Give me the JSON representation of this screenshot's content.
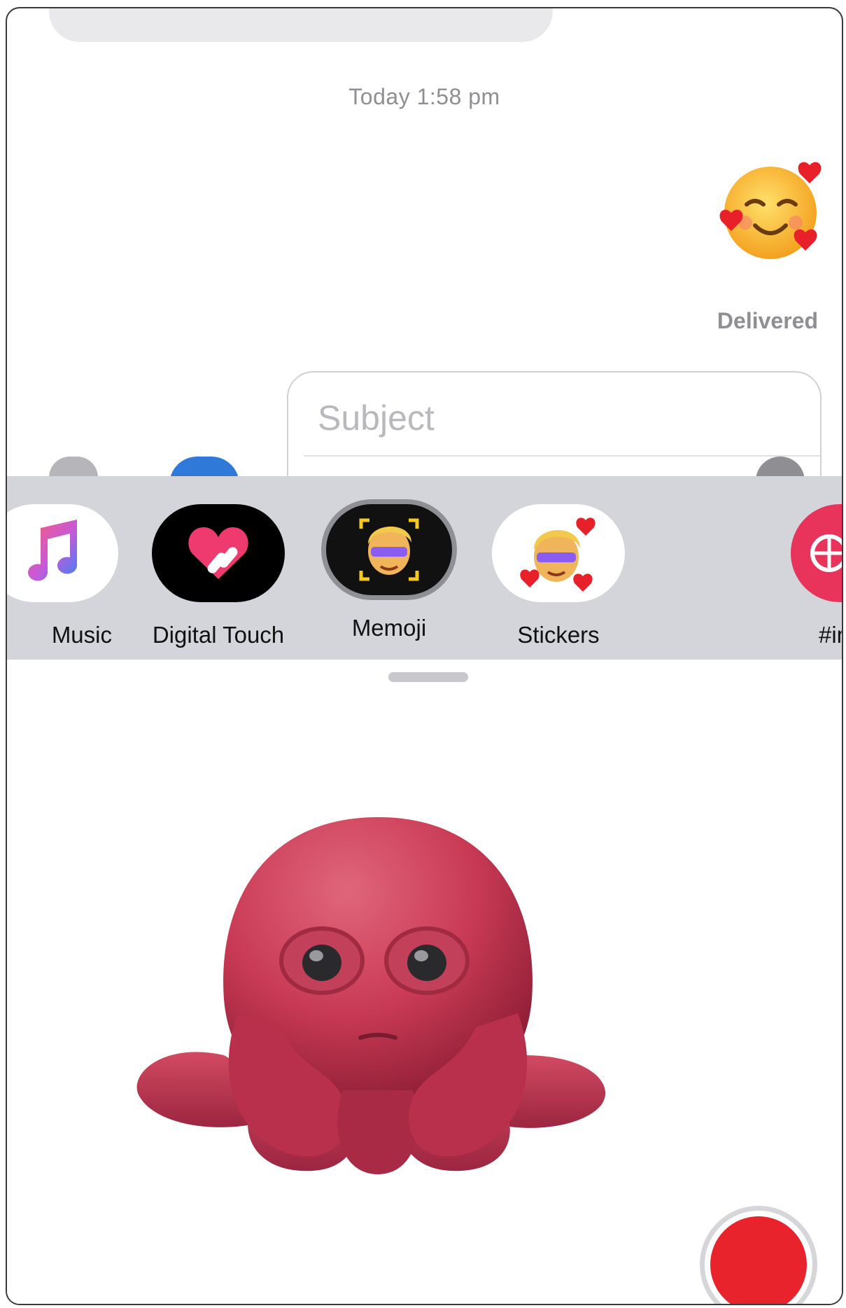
{
  "conversation": {
    "timestamp": "Today 1:58 pm",
    "sent_emoji_icon": "smiling-face-with-hearts-icon",
    "delivery_status": "Delivered"
  },
  "compose": {
    "subject_placeholder": "Subject"
  },
  "app_strip": {
    "apps": [
      {
        "label": "Music",
        "icon": "music-note-icon"
      },
      {
        "label": "Digital Touch",
        "icon": "digital-touch-heart-icon"
      },
      {
        "label": "Memoji",
        "icon": "memoji-icon",
        "selected": true
      },
      {
        "label": "Stickers",
        "icon": "memoji-stickers-icon"
      },
      {
        "label": "#im",
        "icon": "images-globe-icon"
      }
    ]
  },
  "memoji_panel": {
    "character": "octopus-memoji",
    "record_button_color": "#e8232c"
  },
  "colors": {
    "strip_bg": "#d3d5da",
    "secondary_text": "#8e8e93",
    "accent_red": "#e8232c"
  }
}
